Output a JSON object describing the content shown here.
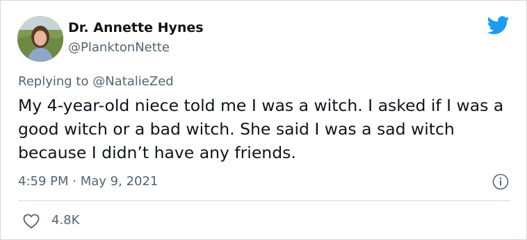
{
  "author": {
    "name": "Dr. Annette Hynes",
    "handle": "@PlanktonNette"
  },
  "reply": {
    "prefix": "Replying to",
    "mention": "@NatalieZed"
  },
  "tweet": {
    "text": "My 4-year-old niece told me I was a witch. I asked if I was a good witch or a bad witch. She said I was a sad witch because I didn’t have any friends."
  },
  "meta": {
    "time": "4:59 PM",
    "separator": "·",
    "date": "May 9, 2021"
  },
  "engagement": {
    "likes": "4.8K"
  },
  "colors": {
    "twitter_blue": "#1d9bf0",
    "secondary_text": "#536471",
    "border": "#cfd9de"
  },
  "icons": {
    "brand": "twitter-bird-icon",
    "info": "info-icon",
    "like": "heart-icon"
  }
}
